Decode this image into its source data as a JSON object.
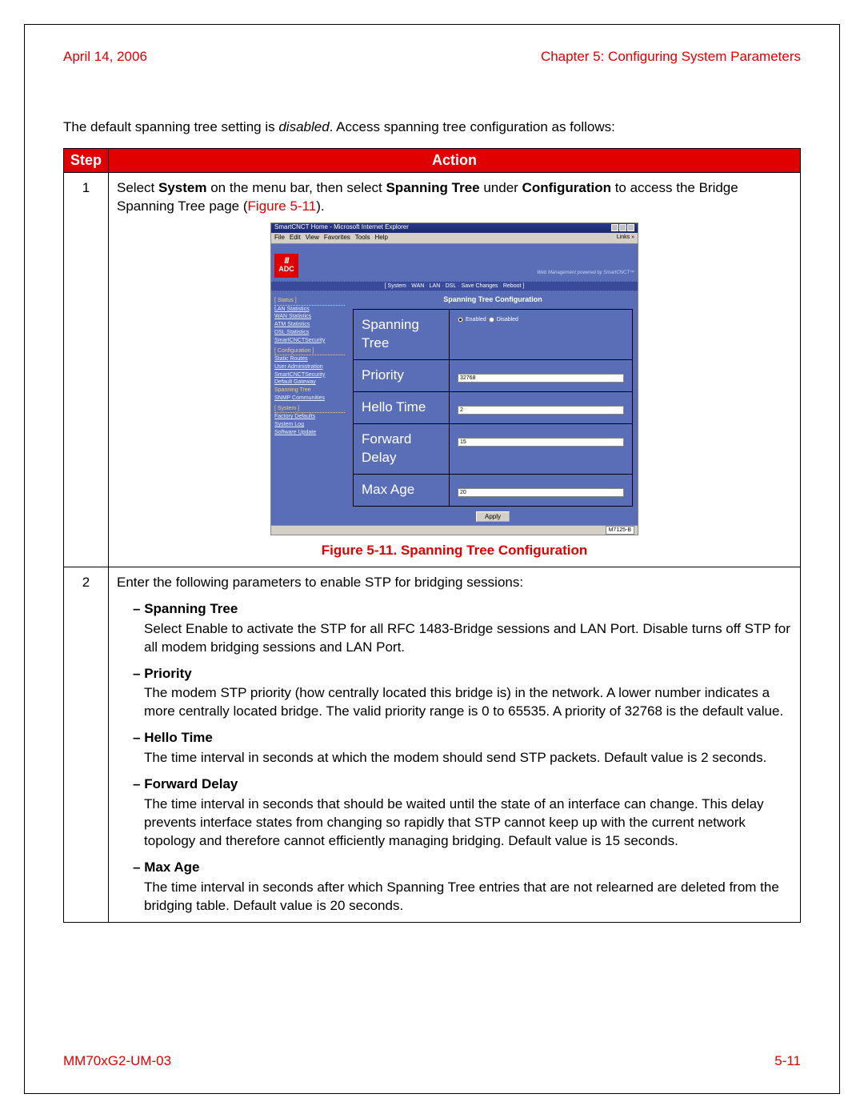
{
  "header": {
    "date": "April 14, 2006",
    "chapter": "Chapter 5: Configuring System Parameters"
  },
  "intro": {
    "part1": "The default spanning tree setting is ",
    "italic": "disabled",
    "part2": ". Access spanning tree configuration as follows:"
  },
  "table_headers": {
    "step": "Step",
    "action": "Action"
  },
  "step1": {
    "num": "1",
    "text_a": "Select ",
    "text_b": "System",
    "text_c": " on the menu bar, then select ",
    "text_d": "Spanning Tree",
    "text_e": " under ",
    "text_f": "Configuration",
    "text_g": " to access the Bridge Spanning Tree page (",
    "fig_ref": "Figure 5-11",
    "text_h": ")."
  },
  "figure_caption": "Figure 5-11. Spanning Tree Configuration",
  "step2": {
    "num": "2",
    "intro": "Enter the following parameters to enable STP for bridging sessions:",
    "params": {
      "spanning_tree": {
        "title": "Spanning Tree",
        "desc": "Select Enable to activate the STP for all RFC 1483-Bridge sessions and LAN Port. Disable turns off STP for all modem bridging sessions and LAN Port."
      },
      "priority": {
        "title": "Priority",
        "desc": "The modem STP priority (how centrally located this bridge is) in the network. A lower number indicates a more centrally located bridge. The valid priority range is 0 to 65535. A priority of 32768 is the default value."
      },
      "hello_time": {
        "title": "Hello Time",
        "desc": "The time interval in seconds at which the modem should send STP packets. Default value is 2 seconds."
      },
      "forward_delay": {
        "title": "Forward Delay",
        "desc": "The time interval in seconds that should be waited until the state of an interface can change. This delay prevents interface states from changing so rapidly that STP cannot keep up with the current network topology and therefore cannot efficiently managing bridging. Default value is 15 seconds."
      },
      "max_age": {
        "title": "Max Age",
        "desc": "The time interval in seconds after which Spanning Tree entries that are not relearned are deleted from the bridging table. Default value is 20 seconds."
      }
    }
  },
  "screenshot": {
    "window_title": "SmartCNCT Home - Microsoft Internet Explorer",
    "menu": {
      "file": "File",
      "edit": "Edit",
      "view": "View",
      "favorites": "Favorites",
      "tools": "Tools",
      "help": "Help",
      "links": "Links »"
    },
    "logo": "ADC",
    "powered": "Web Management powered by SmartCNCT™",
    "nav": {
      "system": "System",
      "wan": "WAN",
      "lan": "LAN",
      "dsl": "DSL",
      "save": "Save Changes",
      "reboot": "Reboot"
    },
    "side": {
      "status_hdr": "Status",
      "lan": "LAN Statistics",
      "wan": "WAN Statistics",
      "atm": "ATM Statistics",
      "dsl": "DSL Statistics",
      "sec1": "SmartCNCTSecurity",
      "config_hdr": "Configuration",
      "static": "Static Routes",
      "useradm": "User Administration",
      "sec2": "SmartCNCTSecurity",
      "defgw": "Default Gateway",
      "span": "Spanning Tree",
      "snmp": "SNMP Communities",
      "system_hdr": "System",
      "factory": "Factory Defaults",
      "syslog": "System Log",
      "swupd": "Software Update"
    },
    "cfg": {
      "title": "Spanning Tree Configuration",
      "spanning_tree": "Spanning Tree",
      "enabled": "Enabled",
      "disabled": "Disabled",
      "priority": "Priority",
      "priority_val": "32768",
      "hello": "Hello Time",
      "hello_val": "2",
      "fwd": "Forward Delay",
      "fwd_val": "15",
      "maxage": "Max Age",
      "maxage_val": "20",
      "apply": "Apply"
    },
    "footer_tag": "M7125-B"
  },
  "footer": {
    "doc": "MM70xG2-UM-03",
    "page": "5-11"
  }
}
